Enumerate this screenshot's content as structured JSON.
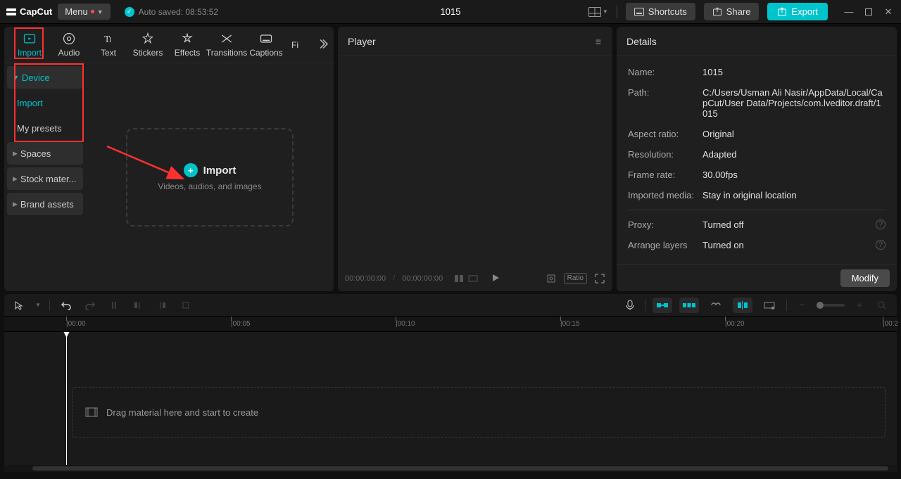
{
  "app": {
    "name": "CapCut",
    "menu_label": "Menu",
    "autosave_label": "Auto saved: 08:53:52",
    "project_title": "1015",
    "shortcuts_label": "Shortcuts",
    "share_label": "Share",
    "export_label": "Export"
  },
  "media_tabs": [
    {
      "label": "Import",
      "icon": "import-media-icon",
      "active": true
    },
    {
      "label": "Audio",
      "icon": "audio-icon"
    },
    {
      "label": "Text",
      "icon": "text-icon"
    },
    {
      "label": "Stickers",
      "icon": "stickers-icon"
    },
    {
      "label": "Effects",
      "icon": "effects-icon"
    },
    {
      "label": "Transitions",
      "icon": "transitions-icon"
    },
    {
      "label": "Captions",
      "icon": "captions-icon"
    },
    {
      "label": "Fi",
      "icon": "filters-icon"
    }
  ],
  "sidebar": {
    "groups": [
      {
        "label": "Device",
        "expanded": true,
        "active": true,
        "children": [
          {
            "label": "Import",
            "active": true
          },
          {
            "label": "My presets"
          }
        ]
      },
      {
        "label": "Spaces"
      },
      {
        "label": "Stock mater..."
      },
      {
        "label": "Brand assets"
      }
    ]
  },
  "import_zone": {
    "title": "Import",
    "subtitle": "Videos, audios, and images"
  },
  "player": {
    "title": "Player",
    "current_time": "00:00:00:00",
    "total_time": "00:00:00:00",
    "ratio_label": "Ratio"
  },
  "details": {
    "title": "Details",
    "rows": [
      {
        "label": "Name:",
        "value": "1015"
      },
      {
        "label": "Path:",
        "value": "C:/Users/Usman Ali Nasir/AppData/Local/CapCut/User Data/Projects/com.lveditor.draft/1015"
      },
      {
        "label": "Aspect ratio:",
        "value": "Original"
      },
      {
        "label": "Resolution:",
        "value": "Adapted"
      },
      {
        "label": "Frame rate:",
        "value": "30.00fps"
      },
      {
        "label": "Imported media:",
        "value": "Stay in original location"
      }
    ],
    "rows2": [
      {
        "label": "Proxy:",
        "value": "Turned off",
        "help": true
      },
      {
        "label": "Arrange layers",
        "value": "Turned on",
        "help": true
      }
    ],
    "modify_label": "Modify"
  },
  "timeline": {
    "ticks": [
      "|00:00",
      "|00:05",
      "|00:10",
      "|00:15",
      "|00:20",
      "|00:2"
    ],
    "drag_hint": "Drag material here and start to create"
  }
}
